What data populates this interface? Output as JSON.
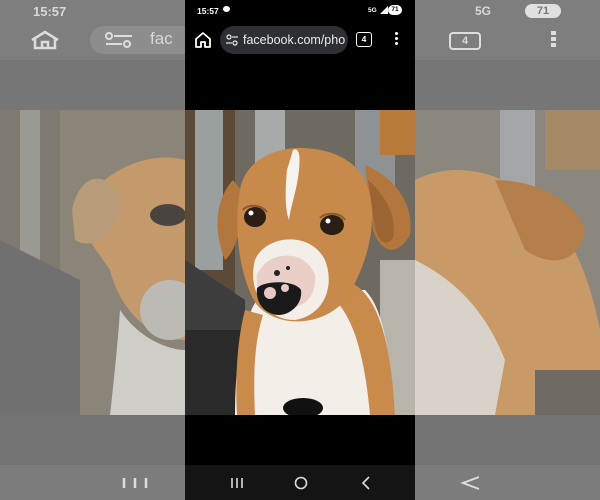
{
  "status_bar": {
    "time": "15:57",
    "network": "5G",
    "battery": "71"
  },
  "browser": {
    "url": "facebook.com/pho",
    "tab_count": "4"
  },
  "backdrop": {
    "time": "15:57",
    "url_fragment": "fac",
    "network": "5G",
    "battery": "71",
    "tab_count": "4"
  },
  "photo": {
    "subject": "dog",
    "icon_names": [
      "home-icon",
      "tune-icon",
      "tabs-icon",
      "more-vert-icon",
      "recents-icon",
      "home-circle-icon",
      "back-icon"
    ]
  },
  "colors": {
    "phone_background": "#000000",
    "omnibox": "#2d2f33",
    "navbar": "#141414",
    "backdrop": "#7a7a7a"
  }
}
